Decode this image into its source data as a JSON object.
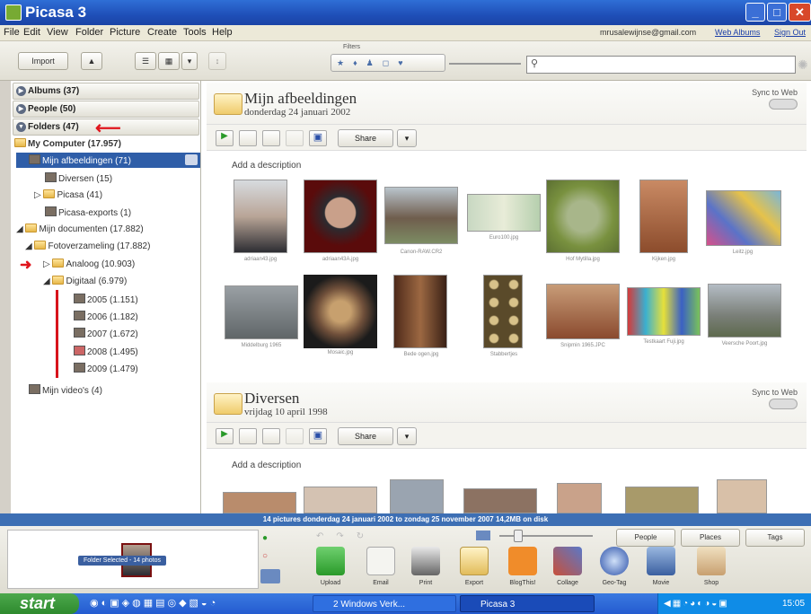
{
  "window": {
    "title": "Picasa 3"
  },
  "menu": {
    "items": [
      "File",
      "Edit",
      "View",
      "Folder",
      "Picture",
      "Create",
      "Tools",
      "Help"
    ],
    "account": "mrusalewijnse@gmail.com",
    "web_albums": "Web Albums",
    "sign_out": "Sign Out"
  },
  "toolbar": {
    "import_label": "Import",
    "filters_label": "Filters"
  },
  "sidebar": {
    "albums": "Albums (37)",
    "people": "People (50)",
    "folders": "Folders (47)",
    "my_computer": "My Computer (17.957)",
    "selected": "Mijn afbeeldingen (71)",
    "tree": [
      "Diversen (15)",
      "Picasa (41)",
      "Picasa-exports (1)",
      "Mijn documenten (17.882)",
      "Fotoverzameling (17.882)",
      "Analoog (10.903)",
      "Digitaal (6.979)",
      "2005 (1.151)",
      "2006 (1.182)",
      "2007 (1.672)",
      "2008 (1.495)",
      "2009 (1.479)",
      "Mijn video's (4)"
    ]
  },
  "sections": [
    {
      "title": "Mijn afbeeldingen",
      "date": "donderdag 24 januari 2002",
      "sync": "Sync to Web",
      "share": "Share",
      "desc": "Add a description",
      "photos": [
        "adriaan43.jpg",
        "adriaan43A.jpg",
        "Canon-RAW.CR2",
        "Euro100.jpg",
        "Hof Mytilla.jpg",
        "Kijken.jpg",
        "Leitz.jpg",
        "Middelburg 1965",
        "Mosaic.jpg",
        "Bede ogen.jpg",
        "Stabbertjes",
        "Snipmin 1965.JPC",
        "Testkaart Fuji.jpg",
        "Veersche Poort.jpg"
      ]
    },
    {
      "title": "Diversen",
      "date": "vrijdag 10 april 1998",
      "sync": "Sync to Web",
      "share": "Share",
      "desc": "Add a description"
    }
  ],
  "status": {
    "text": "14 pictures    donderdag 24 januari 2002 to zondag 25 november 2007    14,2MB on disk"
  },
  "bottom": {
    "selection": "Folder Selected - 14 photos",
    "people": "People",
    "places": "Places",
    "tags": "Tags",
    "actions": [
      "Upload",
      "Email",
      "Print",
      "Export",
      "BlogThis!",
      "Collage",
      "Geo-Tag",
      "Movie",
      "Shop"
    ]
  },
  "taskbar": {
    "start": "start",
    "task1": "2 Windows Verk...",
    "task2": "Picasa 3",
    "clock": "15:05"
  }
}
